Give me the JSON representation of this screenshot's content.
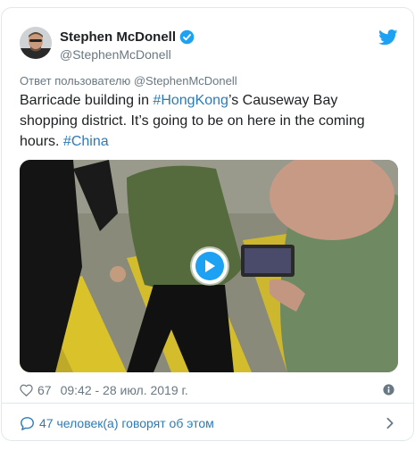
{
  "author": {
    "name": "Stephen McDonell",
    "handle": "@StephenMcDonell",
    "verified": true
  },
  "reply_to": "Ответ пользователю @StephenMcDonell",
  "tweet": {
    "text_1": "Barricade building in ",
    "hashtag_1": "#HongKong",
    "text_2": "’s Causeway Bay shopping district. It’s going to be on here in the coming hours. ",
    "hashtag_2": "#China"
  },
  "media": {
    "type": "video",
    "play_icon": "play-icon"
  },
  "meta": {
    "like_count": "67",
    "timestamp": "09:42 - 28 июл. 2019 г."
  },
  "footer": {
    "conversation_label": "47 человек(а) говорят об этом"
  },
  "colors": {
    "accent": "#1da1f2",
    "link": "#2b7bb9",
    "muted": "#697882",
    "border": "#e1e8ed"
  }
}
